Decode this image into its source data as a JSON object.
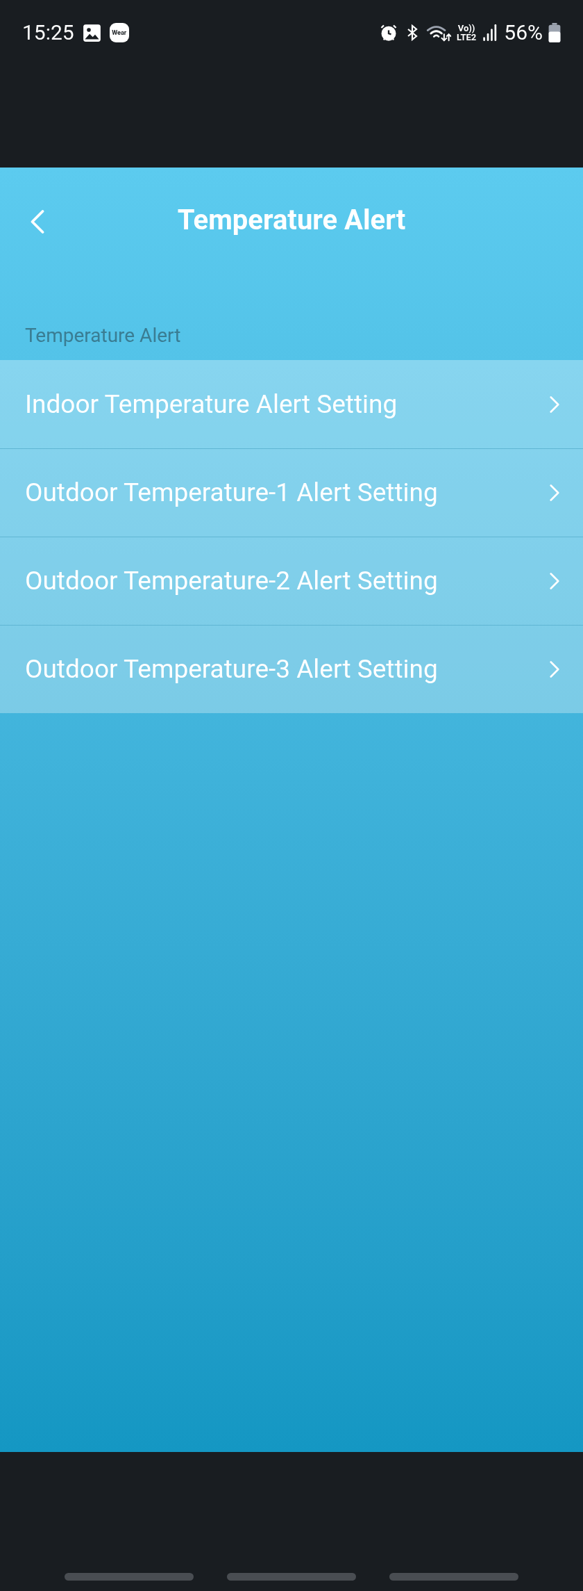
{
  "status_bar": {
    "time": "15:25",
    "app_badge": "Wear",
    "volte": "Vo))",
    "network": "LTE2",
    "battery": "56%"
  },
  "header": {
    "title": "Temperature Alert"
  },
  "section": {
    "label": "Temperature Alert"
  },
  "items": [
    {
      "label": "Indoor Temperature Alert Setting"
    },
    {
      "label": "Outdoor Temperature-1 Alert Setting"
    },
    {
      "label": "Outdoor Temperature-2 Alert Setting"
    },
    {
      "label": "Outdoor Temperature-3 Alert Setting"
    }
  ]
}
